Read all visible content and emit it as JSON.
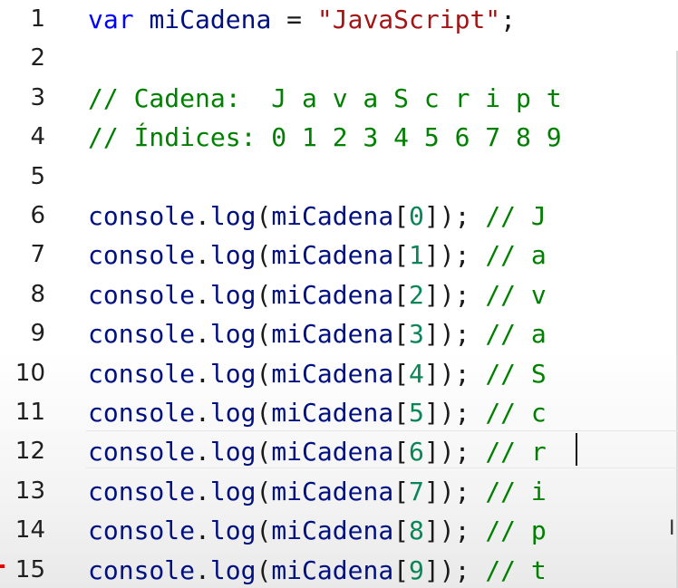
{
  "editor": {
    "lines": [
      {
        "num": "1",
        "tokens": [
          {
            "t": "var",
            "c": "kw"
          },
          {
            "t": " ",
            "c": "punct"
          },
          {
            "t": "miCadena",
            "c": "ident"
          },
          {
            "t": " = ",
            "c": "punct"
          },
          {
            "t": "\"JavaScript\"",
            "c": "str"
          },
          {
            "t": ";",
            "c": "punct"
          }
        ]
      },
      {
        "num": "2",
        "tokens": []
      },
      {
        "num": "3",
        "tokens": [
          {
            "t": "// Cadena:  J a v a S c r i p t",
            "c": "comment"
          }
        ]
      },
      {
        "num": "4",
        "tokens": [
          {
            "t": "// Índices: 0 1 2 3 4 5 6 7 8 9",
            "c": "comment"
          }
        ]
      },
      {
        "num": "5",
        "tokens": []
      },
      {
        "num": "6",
        "tokens": [
          {
            "t": "console",
            "c": "ident"
          },
          {
            "t": ".",
            "c": "punct"
          },
          {
            "t": "log",
            "c": "ident"
          },
          {
            "t": "(",
            "c": "punct"
          },
          {
            "t": "miCadena",
            "c": "ident"
          },
          {
            "t": "[",
            "c": "punct"
          },
          {
            "t": "0",
            "c": "num"
          },
          {
            "t": "]);",
            "c": "punct"
          },
          {
            "t": " // J",
            "c": "comment"
          }
        ]
      },
      {
        "num": "7",
        "tokens": [
          {
            "t": "console",
            "c": "ident"
          },
          {
            "t": ".",
            "c": "punct"
          },
          {
            "t": "log",
            "c": "ident"
          },
          {
            "t": "(",
            "c": "punct"
          },
          {
            "t": "miCadena",
            "c": "ident"
          },
          {
            "t": "[",
            "c": "punct"
          },
          {
            "t": "1",
            "c": "num"
          },
          {
            "t": "]);",
            "c": "punct"
          },
          {
            "t": " // a",
            "c": "comment"
          }
        ]
      },
      {
        "num": "8",
        "tokens": [
          {
            "t": "console",
            "c": "ident"
          },
          {
            "t": ".",
            "c": "punct"
          },
          {
            "t": "log",
            "c": "ident"
          },
          {
            "t": "(",
            "c": "punct"
          },
          {
            "t": "miCadena",
            "c": "ident"
          },
          {
            "t": "[",
            "c": "punct"
          },
          {
            "t": "2",
            "c": "num"
          },
          {
            "t": "]);",
            "c": "punct"
          },
          {
            "t": " // v",
            "c": "comment"
          }
        ]
      },
      {
        "num": "9",
        "tokens": [
          {
            "t": "console",
            "c": "ident"
          },
          {
            "t": ".",
            "c": "punct"
          },
          {
            "t": "log",
            "c": "ident"
          },
          {
            "t": "(",
            "c": "punct"
          },
          {
            "t": "miCadena",
            "c": "ident"
          },
          {
            "t": "[",
            "c": "punct"
          },
          {
            "t": "3",
            "c": "num"
          },
          {
            "t": "]);",
            "c": "punct"
          },
          {
            "t": " // a",
            "c": "comment"
          }
        ]
      },
      {
        "num": "10",
        "tokens": [
          {
            "t": "console",
            "c": "ident"
          },
          {
            "t": ".",
            "c": "punct"
          },
          {
            "t": "log",
            "c": "ident"
          },
          {
            "t": "(",
            "c": "punct"
          },
          {
            "t": "miCadena",
            "c": "ident"
          },
          {
            "t": "[",
            "c": "punct"
          },
          {
            "t": "4",
            "c": "num"
          },
          {
            "t": "]);",
            "c": "punct"
          },
          {
            "t": " // S",
            "c": "comment"
          }
        ]
      },
      {
        "num": "11",
        "tokens": [
          {
            "t": "console",
            "c": "ident"
          },
          {
            "t": ".",
            "c": "punct"
          },
          {
            "t": "log",
            "c": "ident"
          },
          {
            "t": "(",
            "c": "punct"
          },
          {
            "t": "miCadena",
            "c": "ident"
          },
          {
            "t": "[",
            "c": "punct"
          },
          {
            "t": "5",
            "c": "num"
          },
          {
            "t": "]);",
            "c": "punct"
          },
          {
            "t": " // c",
            "c": "comment"
          }
        ]
      },
      {
        "num": "12",
        "tokens": [
          {
            "t": "console",
            "c": "ident"
          },
          {
            "t": ".",
            "c": "punct"
          },
          {
            "t": "log",
            "c": "ident"
          },
          {
            "t": "(",
            "c": "punct"
          },
          {
            "t": "miCadena",
            "c": "ident"
          },
          {
            "t": "[",
            "c": "punct"
          },
          {
            "t": "6",
            "c": "num"
          },
          {
            "t": "]);",
            "c": "punct"
          },
          {
            "t": " // r",
            "c": "comment"
          }
        ]
      },
      {
        "num": "13",
        "tokens": [
          {
            "t": "console",
            "c": "ident"
          },
          {
            "t": ".",
            "c": "punct"
          },
          {
            "t": "log",
            "c": "ident"
          },
          {
            "t": "(",
            "c": "punct"
          },
          {
            "t": "miCadena",
            "c": "ident"
          },
          {
            "t": "[",
            "c": "punct"
          },
          {
            "t": "7",
            "c": "num"
          },
          {
            "t": "]);",
            "c": "punct"
          },
          {
            "t": " // i",
            "c": "comment"
          }
        ]
      },
      {
        "num": "14",
        "tokens": [
          {
            "t": "console",
            "c": "ident"
          },
          {
            "t": ".",
            "c": "punct"
          },
          {
            "t": "log",
            "c": "ident"
          },
          {
            "t": "(",
            "c": "punct"
          },
          {
            "t": "miCadena",
            "c": "ident"
          },
          {
            "t": "[",
            "c": "punct"
          },
          {
            "t": "8",
            "c": "num"
          },
          {
            "t": "]);",
            "c": "punct"
          },
          {
            "t": " // p",
            "c": "comment"
          }
        ]
      },
      {
        "num": "15",
        "tokens": [
          {
            "t": "console",
            "c": "ident"
          },
          {
            "t": ".",
            "c": "punct"
          },
          {
            "t": "log",
            "c": "ident"
          },
          {
            "t": "(",
            "c": "punct"
          },
          {
            "t": "miCadena",
            "c": "ident"
          },
          {
            "t": "[",
            "c": "punct"
          },
          {
            "t": "9",
            "c": "num"
          },
          {
            "t": "]);",
            "c": "punct"
          },
          {
            "t": " // t",
            "c": "comment"
          }
        ]
      }
    ],
    "current_line": "12",
    "mouse_cursor": "ibeam-icon",
    "colors": {
      "keyword": "#0000ff",
      "identifier": "#001080",
      "string": "#a31515",
      "comment": "#008000",
      "number": "#098658"
    }
  }
}
